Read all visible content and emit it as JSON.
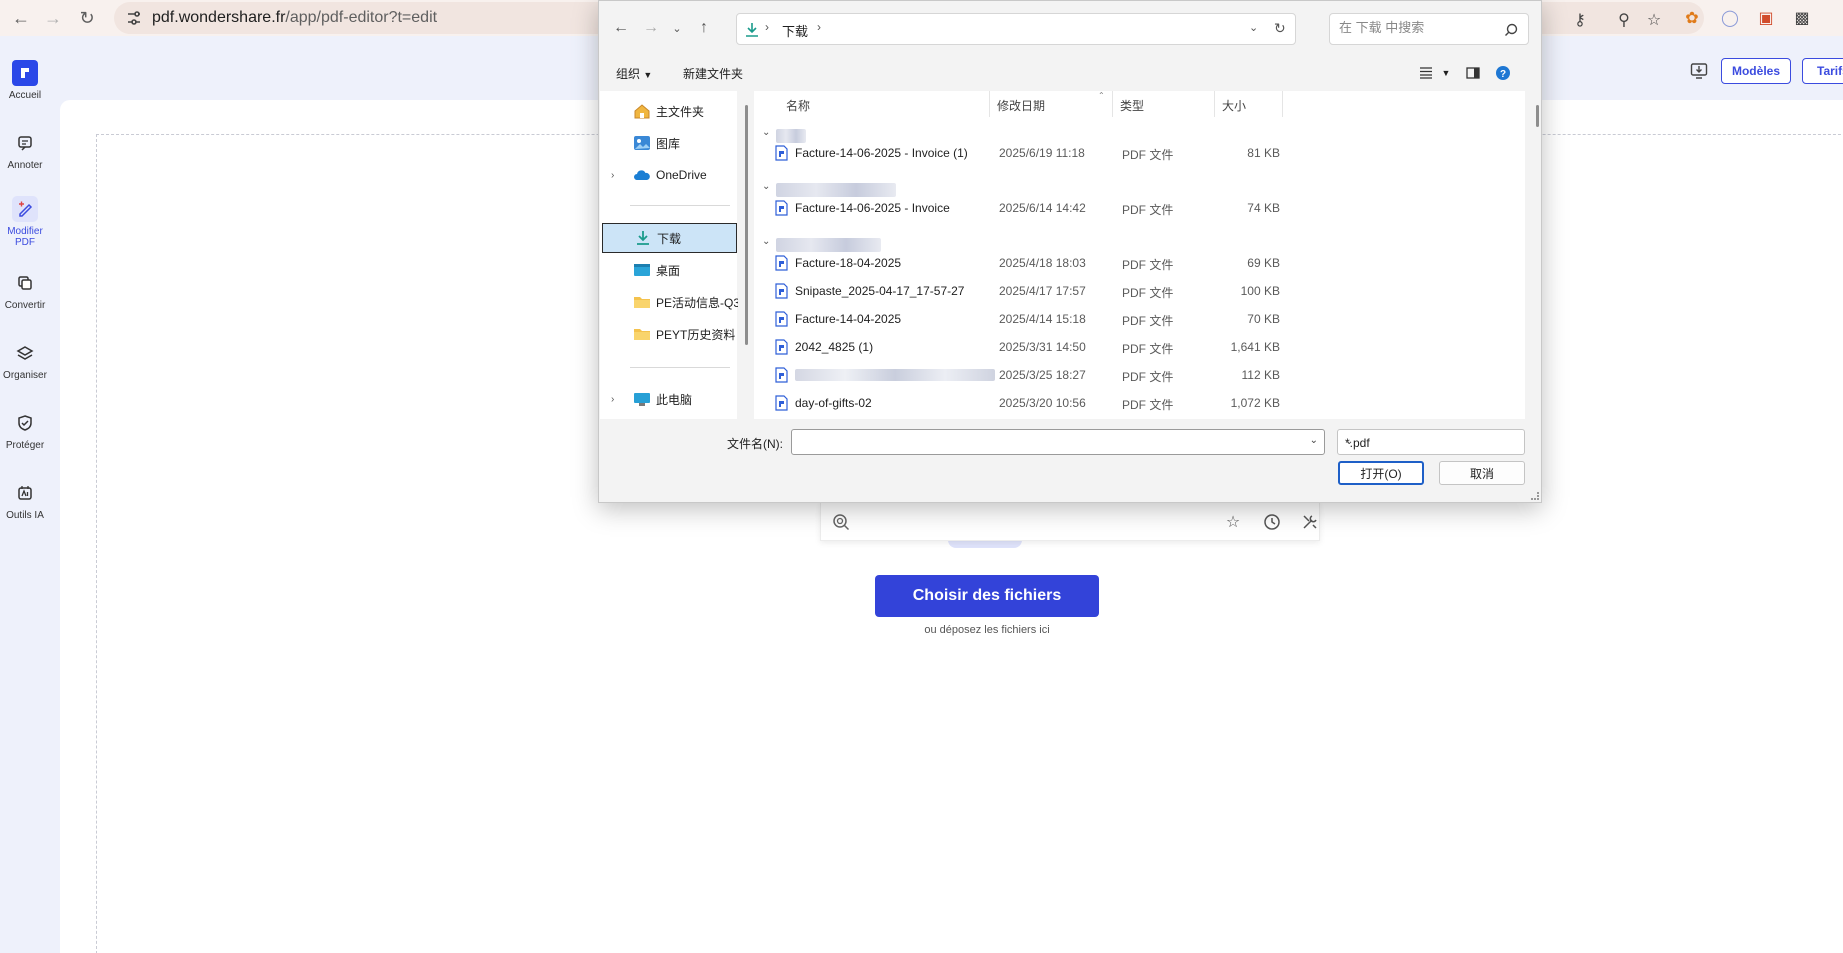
{
  "browser": {
    "url_host": "pdf.wondershare.fr",
    "url_path": "/app/pdf-editor?t=edit"
  },
  "sidebar": {
    "items": [
      {
        "label": "Accueil",
        "icon": "app-logo-icon"
      },
      {
        "label": "Annoter",
        "icon": "annotate-icon"
      },
      {
        "label": "Modifier PDF",
        "icon": "edit-pdf-icon"
      },
      {
        "label": "Convertir",
        "icon": "convert-icon"
      },
      {
        "label": "Organiser",
        "icon": "layers-icon"
      },
      {
        "label": "Protéger",
        "icon": "shield-icon"
      },
      {
        "label": "Outils IA",
        "icon": "ai-tools-icon"
      }
    ]
  },
  "header": {
    "models_label": "Modèles",
    "pricing_label": "Tarifs"
  },
  "main": {
    "choose_files_label": "Choisir des fichiers",
    "drop_hint": "ou déposez les fichiers ici"
  },
  "dialog": {
    "breadcrumb": "下载",
    "search_placeholder": "在 下载 中搜索",
    "organize_label": "组织",
    "new_folder_label": "新建文件夹",
    "tree": [
      {
        "label": "主文件夹",
        "icon": "home-icon"
      },
      {
        "label": "图库",
        "icon": "gallery-icon"
      },
      {
        "label": "OneDrive",
        "icon": "cloud-icon"
      },
      {
        "label": "下载",
        "icon": "download-icon"
      },
      {
        "label": "桌面",
        "icon": "desktop-icon"
      },
      {
        "label": "PE活动信息-Q3",
        "icon": "folder-icon"
      },
      {
        "label": "PEYT历史资料",
        "icon": "folder-icon"
      },
      {
        "label": "此电脑",
        "icon": "computer-icon"
      }
    ],
    "columns": {
      "name": "名称",
      "date": "修改日期",
      "type": "类型",
      "size": "大小"
    },
    "files": [
      {
        "name": "Facture-14-06-2025 - Invoice (1)",
        "date": "2025/6/19 11:18",
        "type": "PDF 文件",
        "size": "81 KB"
      },
      {
        "name": "Facture-14-06-2025 - Invoice",
        "date": "2025/6/14 14:42",
        "type": "PDF 文件",
        "size": "74 KB"
      },
      {
        "name": "Facture-18-04-2025",
        "date": "2025/4/18 18:03",
        "type": "PDF 文件",
        "size": "69 KB"
      },
      {
        "name": "Snipaste_2025-04-17_17-57-27",
        "date": "2025/4/17 17:57",
        "type": "PDF 文件",
        "size": "100 KB"
      },
      {
        "name": "Facture-14-04-2025",
        "date": "2025/4/14 15:18",
        "type": "PDF 文件",
        "size": "70 KB"
      },
      {
        "name": "2042_4825 (1)",
        "date": "2025/3/31 14:50",
        "type": "PDF 文件",
        "size": "1,641 KB"
      },
      {
        "name": "",
        "date": "2025/3/25 18:27",
        "type": "PDF 文件",
        "size": "112 KB"
      },
      {
        "name": "day-of-gifts-02",
        "date": "2025/3/20 10:56",
        "type": "PDF 文件",
        "size": "1,072 KB"
      }
    ],
    "filename_label": "文件名(N):",
    "filename_value": "",
    "filetype_value": "*.pdf",
    "open_label": "打开(O)",
    "cancel_label": "取消"
  }
}
